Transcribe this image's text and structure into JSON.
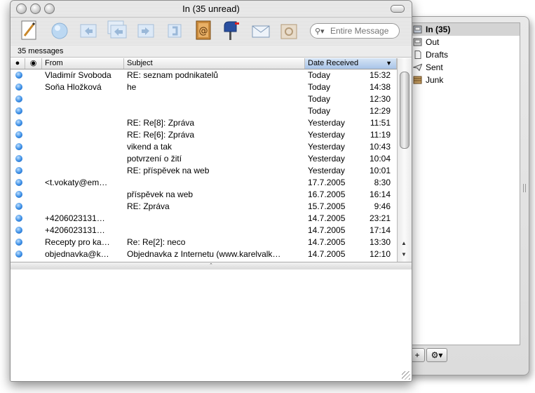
{
  "window": {
    "title": "In (35 unread)"
  },
  "toolbar": {
    "buttons": [
      "compose-icon",
      "get-mail-icon",
      "reply-icon",
      "reply-all-icon",
      "forward-icon",
      "redirect-icon",
      "address-book-icon",
      "mailbox-icon",
      "send-icon",
      "junk-icon"
    ],
    "search_placeholder": "Entire Message"
  },
  "status": {
    "count_text": "35 messages"
  },
  "columns": {
    "from": "From",
    "subject": "Subject",
    "date": "Date Received"
  },
  "messages": [
    {
      "from": "Vladimír Svoboda",
      "subject": "RE: seznam podnikatelů",
      "date": "Today",
      "time": "15:32"
    },
    {
      "from": "Soňa Hložková",
      "subject": "he",
      "date": "Today",
      "time": "14:38"
    },
    {
      "from": "",
      "subject": "",
      "date": "Today",
      "time": "12:30"
    },
    {
      "from": "",
      "subject": "",
      "date": "Today",
      "time": "12:29"
    },
    {
      "from": "",
      "subject": "RE: Re[8]: Zpráva",
      "date": "Yesterday",
      "time": "11:51"
    },
    {
      "from": "",
      "subject": "RE: Re[6]: Zpráva",
      "date": "Yesterday",
      "time": "11:19"
    },
    {
      "from": "",
      "subject": "vikend a tak",
      "date": "Yesterday",
      "time": "10:43"
    },
    {
      "from": "",
      "subject": "potvrzení o žití",
      "date": "Yesterday",
      "time": "10:04"
    },
    {
      "from": "",
      "subject": "RE: příspěvek na web",
      "date": "Yesterday",
      "time": "10:01"
    },
    {
      "from": "<t.vokaty@em…",
      "subject": "",
      "date": "17.7.2005",
      "time": "8:30"
    },
    {
      "from": "",
      "subject": "příspěvek na web",
      "date": "16.7.2005",
      "time": "16:14"
    },
    {
      "from": "",
      "subject": "RE: Zpráva",
      "date": "15.7.2005",
      "time": "9:46"
    },
    {
      "from": "+4206023131…",
      "subject": "",
      "date": "14.7.2005",
      "time": "23:21"
    },
    {
      "from": "+4206023131…",
      "subject": "",
      "date": "14.7.2005",
      "time": "17:14"
    },
    {
      "from": "Recepty pro ka…",
      "subject": "Re: Re[2]: neco",
      "date": "14.7.2005",
      "time": "13:30"
    },
    {
      "from": "objednavka@k…",
      "subject": "Objednavka z Internetu (www.karelvalk…",
      "date": "14.7.2005",
      "time": "12:10"
    }
  ],
  "drawer": {
    "mailboxes": [
      {
        "label": "In (35)",
        "icon": "inbox-icon",
        "selected": true
      },
      {
        "label": "Out",
        "icon": "outbox-icon",
        "selected": false
      },
      {
        "label": "Drafts",
        "icon": "drafts-icon",
        "selected": false
      },
      {
        "label": "Sent",
        "icon": "sent-icon",
        "selected": false
      },
      {
        "label": "Junk",
        "icon": "junk-mailbox-icon",
        "selected": false
      }
    ],
    "add_label": "+",
    "action_label": "⚙▾"
  }
}
